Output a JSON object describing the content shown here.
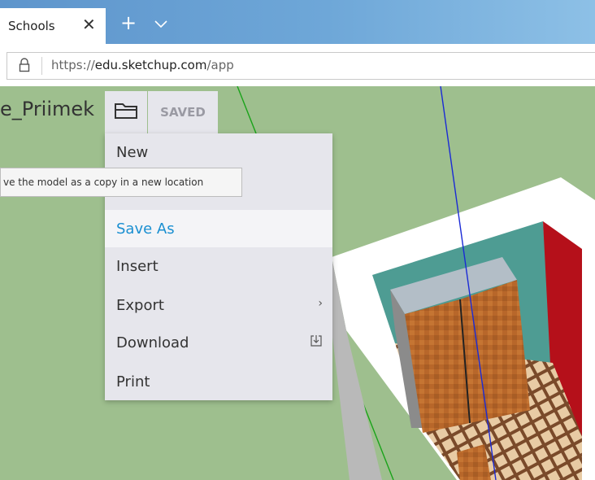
{
  "browser": {
    "tab_title": "Schools",
    "close_glyph": "✕",
    "new_tab_glyph": "+",
    "address": {
      "scheme": "https://",
      "host": "edu.sketchup.com",
      "path": "/app"
    }
  },
  "app": {
    "model_title": "e_Priimek",
    "saved_label": "SAVED",
    "menu": {
      "items": [
        {
          "label": "New"
        },
        {
          "label": "Save As",
          "active": true
        },
        {
          "label": "Insert"
        },
        {
          "label": "Export",
          "arrow": "›"
        },
        {
          "label": "Download"
        },
        {
          "label": "Print"
        }
      ]
    },
    "tooltip": "ve the model as a copy in a new location"
  },
  "colors": {
    "accent": "#1a8fd1",
    "canvas": "#9ebf8e",
    "menu_bg": "#e6e6ec"
  }
}
